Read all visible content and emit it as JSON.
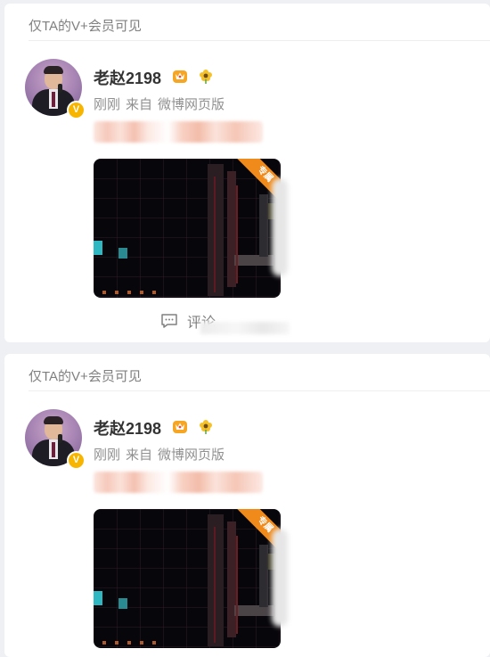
{
  "posts": [
    {
      "visibility_label": "仅TA的V+会员可见",
      "username": "老赵2198",
      "time": "刚刚",
      "source_prefix": "来自",
      "source": "微博网页版",
      "thumbnail_ribbon": "专属",
      "comment_label": "评论",
      "icons": [
        "verified-v-icon",
        "member-crown-icon",
        "flower-icon",
        "comment-icon"
      ]
    },
    {
      "visibility_label": "仅TA的V+会员可见",
      "username": "老赵2198",
      "time": "刚刚",
      "source_prefix": "来自",
      "source": "微博网页版",
      "thumbnail_ribbon": "专属",
      "icons": [
        "verified-v-icon",
        "member-crown-icon",
        "flower-icon"
      ]
    }
  ],
  "colors": {
    "background": "#eef0f3",
    "card": "#ffffff",
    "verified_badge": "#f7b500",
    "ribbon": "#f08a1a",
    "muted_text": "#808080"
  }
}
